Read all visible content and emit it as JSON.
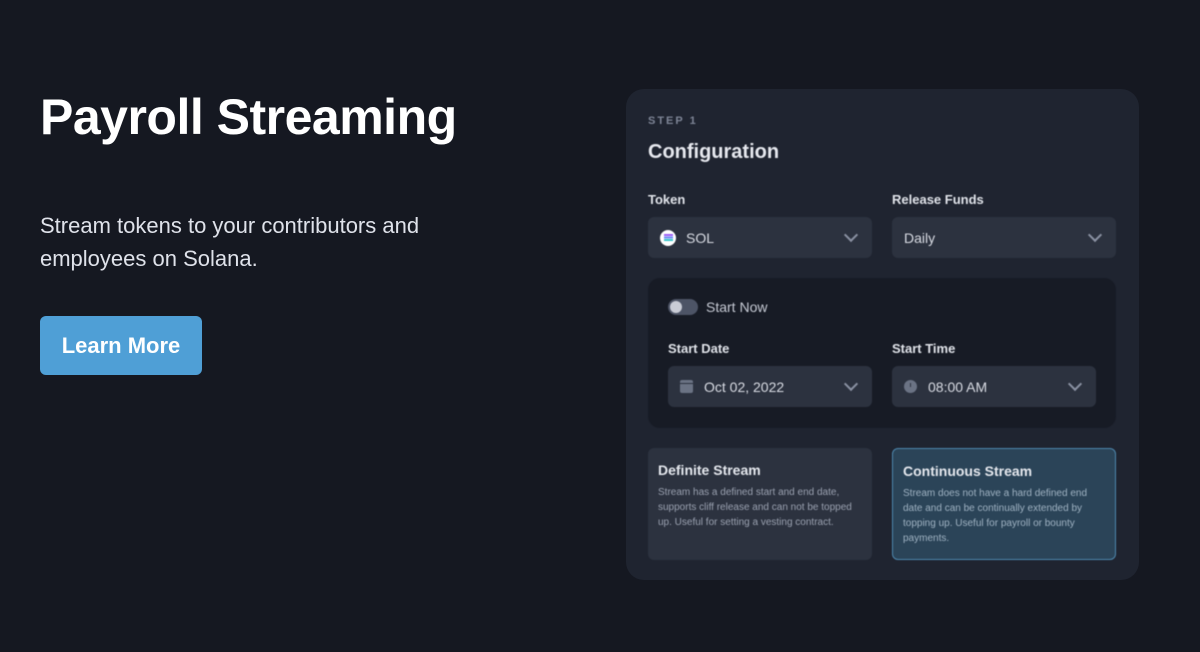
{
  "hero": {
    "title": "Payroll Streaming",
    "subtitle": "Stream tokens to your contributors and employees on Solana.",
    "cta_label": "Learn More",
    "cta_color": "#4f9fd6"
  },
  "config_card": {
    "step_label": "STEP 1",
    "title": "Configuration",
    "token": {
      "label": "Token",
      "value": "SOL",
      "icon": "solana-icon"
    },
    "release_funds": {
      "label": "Release Funds",
      "value": "Daily"
    },
    "start_now": {
      "label": "Start Now",
      "enabled": false
    },
    "start_date": {
      "label": "Start Date",
      "value": "Oct 02, 2022",
      "icon": "calendar-icon"
    },
    "start_time": {
      "label": "Start Time",
      "value": "08:00 AM",
      "icon": "clock-icon"
    },
    "stream_types": [
      {
        "title": "Definite Stream",
        "description": "Stream has a defined start and end date, supports cliff release and can not be topped up. Useful for setting a vesting contract.",
        "selected": false
      },
      {
        "title": "Continuous Stream",
        "description": "Stream does not have a hard defined end date and can be continually extended by topping up. Useful for payroll or bounty payments.",
        "selected": true
      }
    ]
  },
  "colors": {
    "background": "#151821",
    "card": "#1f2430",
    "selected_accent": "#4e87ad"
  }
}
